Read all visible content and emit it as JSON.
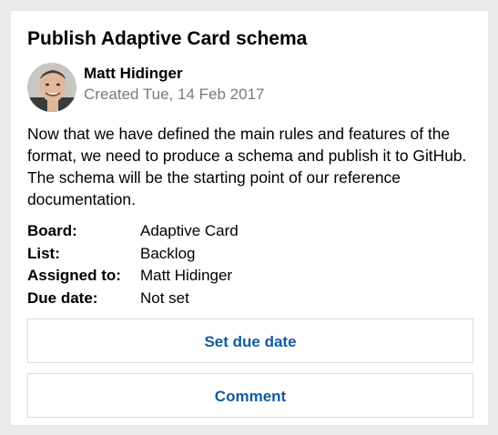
{
  "card": {
    "title": "Publish Adaptive Card schema",
    "author": {
      "name": "Matt Hidinger",
      "created": "Created Tue, 14 Feb 2017",
      "avatar_icon": "person-avatar"
    },
    "description": "Now that we have defined the main rules and features of the format, we need to produce a schema and publish it to GitHub. The schema will be the starting point of our reference documentation.",
    "facts": [
      {
        "key": "Board:",
        "value": "Adaptive Card"
      },
      {
        "key": "List:",
        "value": "Backlog"
      },
      {
        "key": "Assigned to:",
        "value": "Matt Hidinger"
      },
      {
        "key": "Due date:",
        "value": "Not set"
      }
    ],
    "actions": {
      "set_due_date": "Set due date",
      "comment": "Comment"
    }
  },
  "colors": {
    "background": "#e9eaec",
    "card": "#ffffff",
    "accent": "#0f5ba3",
    "subtle_text": "#7a7a7a",
    "button_border": "#d9d9d9"
  }
}
